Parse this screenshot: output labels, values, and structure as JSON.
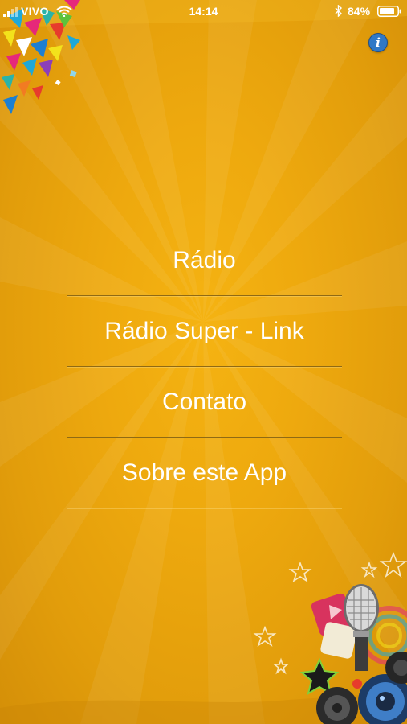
{
  "status_bar": {
    "carrier": "VIVO",
    "time": "14:14",
    "battery_percent": "84%"
  },
  "icons": {
    "info": "info-icon",
    "signal": "signal-bars-icon",
    "wifi": "wifi-icon",
    "bluetooth": "bluetooth-icon",
    "battery": "battery-icon"
  },
  "info_button": {
    "glyph": "i"
  },
  "menu": {
    "items": [
      {
        "label": "Rádio"
      },
      {
        "label": "Rádio Super - Link"
      },
      {
        "label": "Contato"
      },
      {
        "label": "Sobre este App"
      }
    ]
  },
  "colors": {
    "background": "#eea90e",
    "divider": "#8f6a14",
    "info_button": "#2f78c6",
    "text": "#ffffff"
  }
}
